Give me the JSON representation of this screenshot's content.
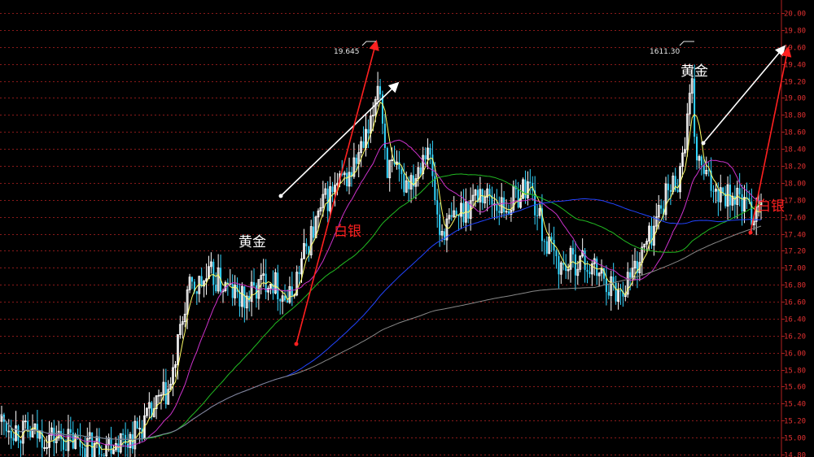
{
  "chart_data": {
    "type": "candlestick",
    "title": "",
    "ylim": [
      14.8,
      20.0
    ],
    "yticks": [
      "20.00",
      "19.80",
      "19.60",
      "19.40",
      "19.20",
      "19.00",
      "18.80",
      "18.60",
      "18.40",
      "18.20",
      "18.00",
      "17.80",
      "17.60",
      "17.40",
      "17.20",
      "17.00",
      "16.80",
      "16.60",
      "16.40",
      "16.20",
      "16.00",
      "15.80",
      "15.60",
      "15.40",
      "15.20",
      "15.00",
      "14.80"
    ],
    "grid": true,
    "series": [
      {
        "kind": "candles",
        "n_bars": 320
      },
      {
        "kind": "ma",
        "color": "#ffff66"
      },
      {
        "kind": "ma",
        "color": "#cc33cc"
      },
      {
        "kind": "ma",
        "color": "#22bb22"
      },
      {
        "kind": "ma",
        "color": "#2244ff"
      },
      {
        "kind": "ma",
        "color": "#888888"
      }
    ],
    "annotations": [
      {
        "text": "黄金",
        "color": "#ffffff"
      },
      {
        "text": "白银",
        "color": "#ff2020"
      },
      {
        "text": "19.645",
        "color": "#e6e6e6"
      },
      {
        "text": "黄金",
        "color": "#ffffff"
      },
      {
        "text": "1611.30",
        "color": "#e6e6e6"
      },
      {
        "text": "白银",
        "color": "#ff2020"
      }
    ]
  }
}
